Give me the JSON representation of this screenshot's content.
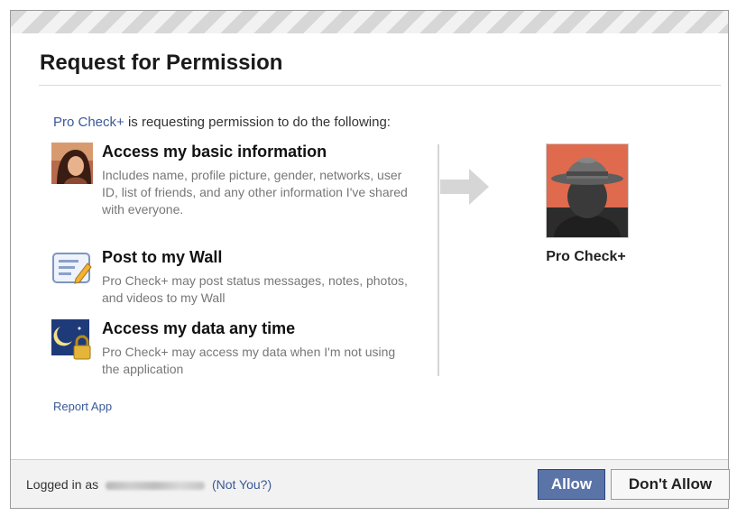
{
  "dialog": {
    "title": "Request for Permission",
    "intro_app": "Pro Check+",
    "intro_text": " is requesting permission to do the following:"
  },
  "permissions": [
    {
      "icon": "user-photo-icon",
      "title": "Access my basic information",
      "description": "Includes name, profile picture, gender, networks, user ID, list of friends, and any other information I've shared with everyone."
    },
    {
      "icon": "wall-post-icon",
      "title": "Post to my Wall",
      "description": "Pro Check+ may post status messages, notes, photos, and videos to my Wall"
    },
    {
      "icon": "offline-access-icon",
      "title": "Access my data any time",
      "description": "Pro Check+ may access my data when I'm not using the application"
    }
  ],
  "app": {
    "name": "Pro Check+",
    "picture": "spy-hat-icon"
  },
  "report_link": "Report App",
  "footer": {
    "logged_in_label": "Logged in as",
    "not_you": "(Not You?)",
    "allow": "Allow",
    "dont_allow": "Don't Allow"
  },
  "colors": {
    "link": "#3b5998",
    "allow_button": "#5b74a8"
  }
}
